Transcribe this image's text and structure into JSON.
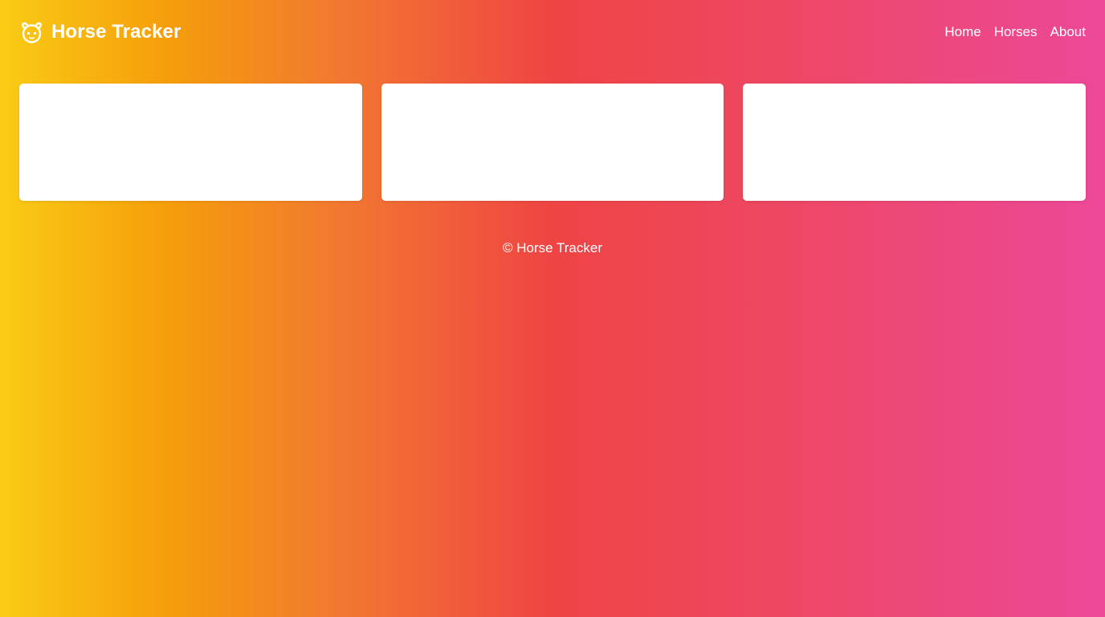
{
  "header": {
    "title": "Horse Tracker",
    "icon": "horse-face-icon"
  },
  "nav": {
    "items": [
      {
        "label": "Home"
      },
      {
        "label": "Horses"
      },
      {
        "label": "About"
      }
    ]
  },
  "cards": [
    {},
    {},
    {}
  ],
  "footer": {
    "text": "© Horse Tracker"
  },
  "colors": {
    "gradient_start": "#facc15",
    "gradient_mid": "#ef4444",
    "gradient_end": "#ec4899",
    "card_background": "#ffffff",
    "text": "#ffffff"
  }
}
